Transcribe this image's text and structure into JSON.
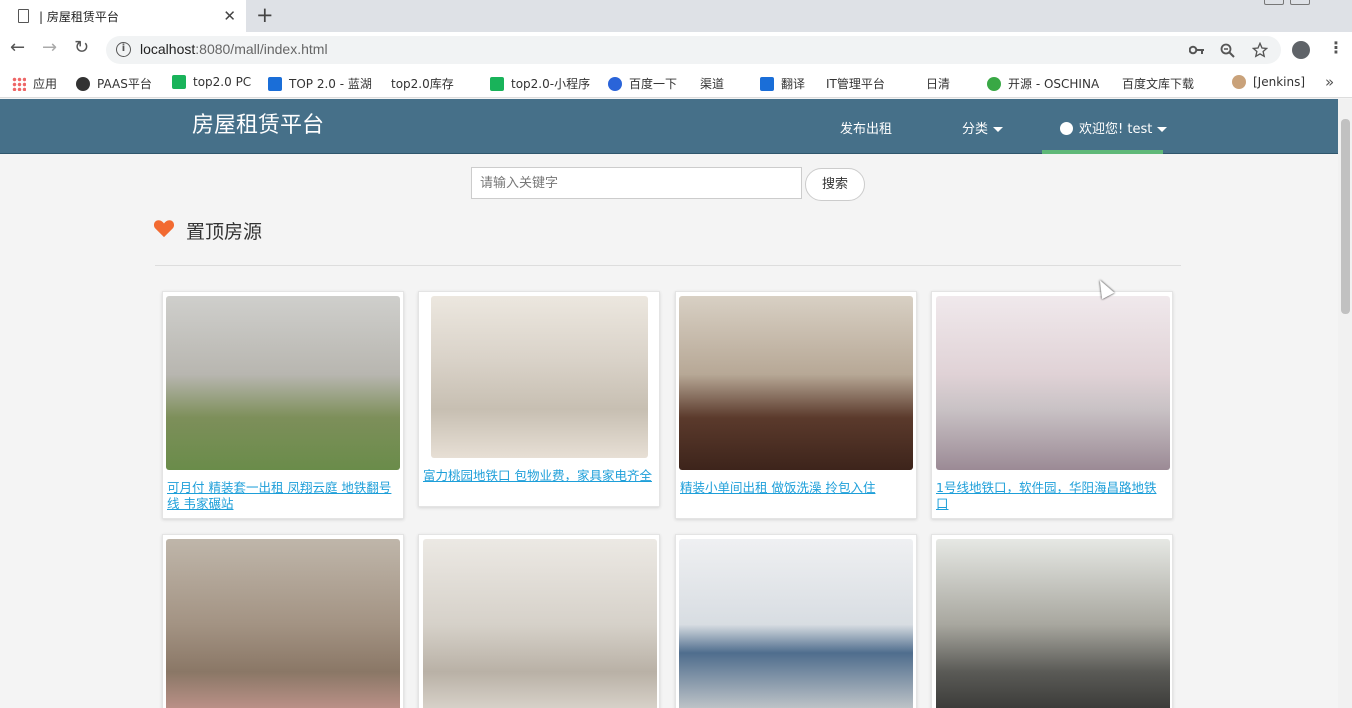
{
  "browser": {
    "tab_title": "| 房屋租赁平台",
    "close_glyph": "✕",
    "new_tab_glyph": "+",
    "back_glyph": "←",
    "forward_glyph": "→",
    "reload_glyph": "↻",
    "url_host": "localhost",
    "url_rest": ":8080/mall/index.html",
    "key_icon": "key-icon",
    "zoom_icon": "zoom-icon",
    "star_icon": "star-icon",
    "more_glyph": "⋮",
    "bookmarks_more_glyph": "»",
    "bookmarks": [
      {
        "label": "应用",
        "icon": "apps-icon"
      },
      {
        "label": "PAAS平台",
        "icon": "paas-icon"
      },
      {
        "label": "top2.0 PC",
        "icon": "play-icon"
      },
      {
        "label": "TOP 2.0 - 蓝湖",
        "icon": "lanhu-icon"
      },
      {
        "label": "top2.0库存",
        "icon": "page-icon"
      },
      {
        "label": "top2.0-小程序",
        "icon": "play-icon"
      },
      {
        "label": "百度一下",
        "icon": "baidu-icon"
      },
      {
        "label": "渠道",
        "icon": "page-icon"
      },
      {
        "label": "翻译",
        "icon": "translate-icon"
      },
      {
        "label": "IT管理平台",
        "icon": "page-icon"
      },
      {
        "label": "日清",
        "icon": "page-icon"
      },
      {
        "label": "开源 - OSCHINA",
        "icon": "oschina-icon"
      },
      {
        "label": "百度文库下载",
        "icon": "page-icon"
      },
      {
        "label": "[Jenkins]",
        "icon": "jenkins-icon"
      }
    ]
  },
  "header": {
    "brand": "房屋租赁平台",
    "publish": "发布出租",
    "category": "分类",
    "user": "欢迎您! test"
  },
  "search": {
    "placeholder": "请输入关键字",
    "button": "搜索"
  },
  "section": {
    "title": "置顶房源"
  },
  "listings": [
    {
      "caption": "可月付 精装套一出租 凤翔云庭 地铁翻号线 韦家碾站"
    },
    {
      "caption": "富力桃园地铁口 包物业费，家具家电齐全"
    },
    {
      "caption": "精装小单间出租 做饭洗澡 拎包入住"
    },
    {
      "caption": "1号线地铁口，软件园，华阳海昌路地铁口"
    },
    {
      "caption": ""
    },
    {
      "caption": ""
    },
    {
      "caption": ""
    },
    {
      "caption": ""
    }
  ],
  "colors": {
    "navbar": "#467089",
    "active_underline": "#5fb878",
    "link": "#1e9fd9",
    "heart": "#f26a31"
  }
}
